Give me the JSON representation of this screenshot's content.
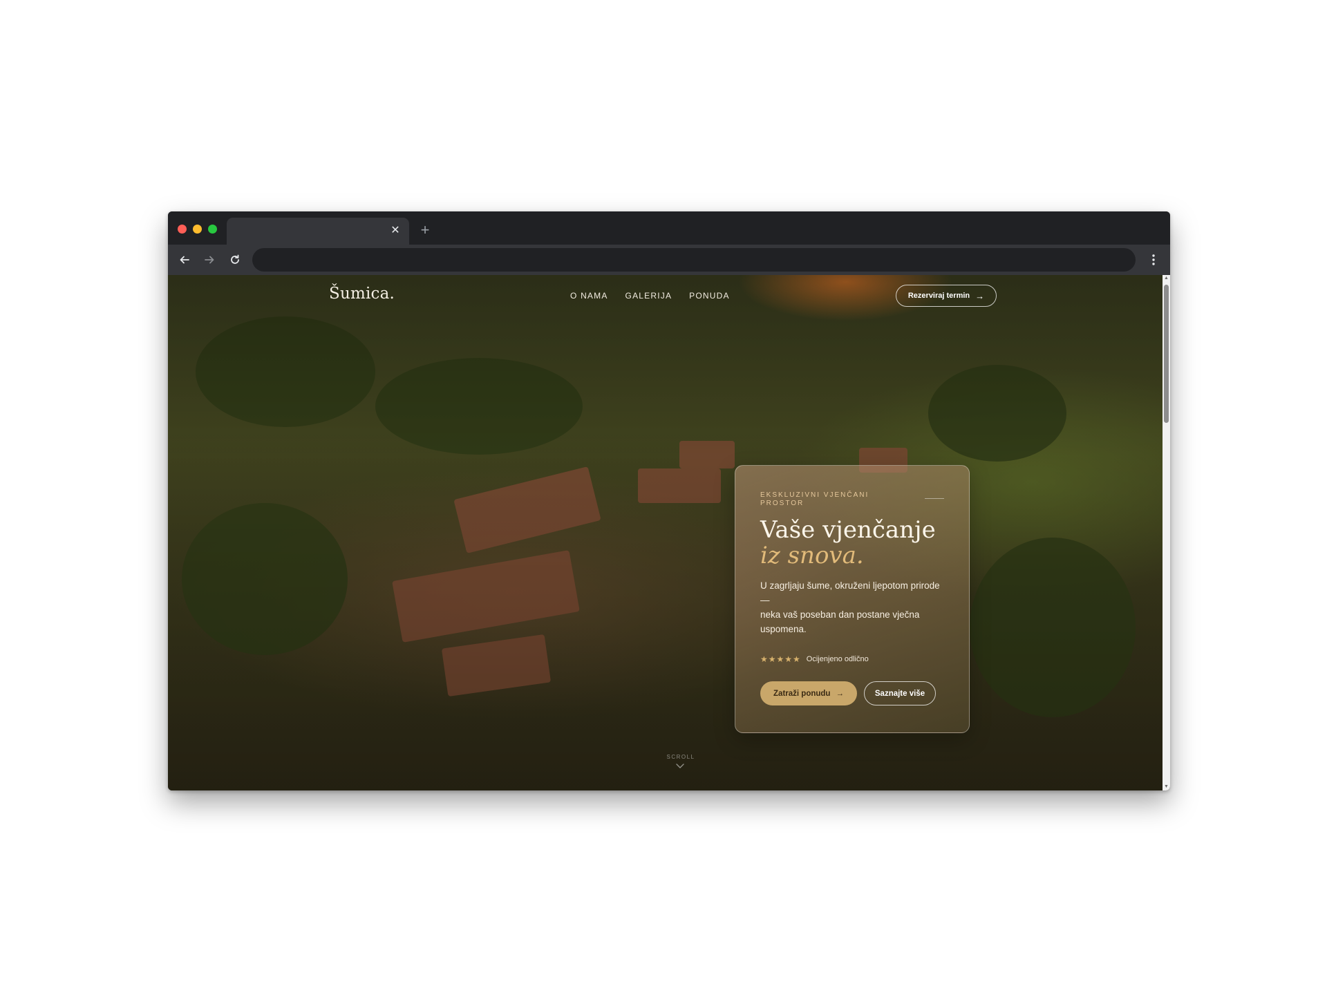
{
  "browser": {
    "tab_close": "✕",
    "new_tab": "+"
  },
  "site": {
    "logo": "Šumica.",
    "nav": [
      "O NAMA",
      "GALERIJA",
      "PONUDA"
    ],
    "cta_top": "Rezerviraj termin",
    "cta_arrow": "→"
  },
  "card": {
    "eyebrow": "EKSKLUZIVNI VJENČANI PROSTOR",
    "title_line1": "Vaše vjenčanje",
    "title_line2": "iz snova.",
    "body_line1": "U zagrljaju šume, okruženi ljepotom prirode —",
    "body_line2": "neka vaš poseban dan postane vječna uspomena.",
    "stars": "★★★★★",
    "rating_text": "Ocijenjeno odlično",
    "primary_button": "Zatraži ponudu",
    "primary_arrow": "→",
    "secondary_button": "Saznajte više"
  },
  "scroll_hint": "SCROLL",
  "colors": {
    "accent_gold": "#c9a76a",
    "title_accent": "#e2bb7a",
    "star_color": "#d8b26d"
  },
  "icons": {
    "back": "arrow-left-icon",
    "forward": "arrow-right-icon",
    "reload": "reload-icon",
    "menu": "kebab-menu-icon",
    "scroll": "chevron-down-icon"
  }
}
